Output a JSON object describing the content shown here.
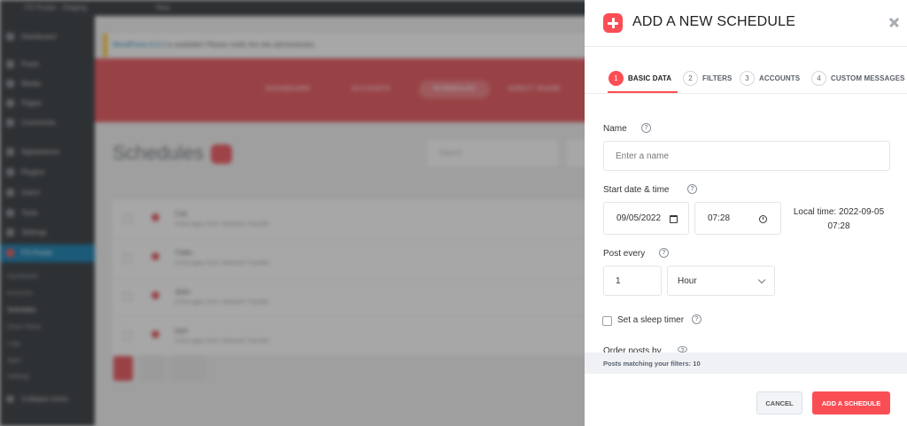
{
  "background": {
    "admin_bar": {
      "site_name": "FS Poster - Staging",
      "new_label": "New"
    },
    "sidebar": {
      "items": [
        "Dashboard",
        "Posts",
        "Media",
        "Pages",
        "Comments",
        "Appearance",
        "Plugins",
        "Users",
        "Tools",
        "Settings",
        "FS Poster"
      ],
      "submenu": [
        "Dashboard",
        "Accounts",
        "Schedules",
        "Direct Share",
        "Logs",
        "Apps",
        "Settings"
      ],
      "collapse": "Collapse menu"
    },
    "notice": {
      "link": "WordPress 6.0.2",
      "text": " is available! Please notify the site administrator."
    },
    "nav": [
      "DASHBOARD",
      "ACCOUNTS",
      "SCHEDULES",
      "DIRECT SHARE"
    ],
    "page_title": "Schedules",
    "search_placeholder": "Search",
    "rows": [
      {
        "title": "Cvb",
        "sub": "A few ages from: Network Transfer"
      },
      {
        "title": "Tvbfo",
        "sub": "A few ages from: Network Transfer"
      },
      {
        "title": "Jjvbv",
        "sub": "A few ages from: Network Transfer"
      },
      {
        "title": "Ioyh",
        "sub": "A few ages from: Network Transfer"
      }
    ]
  },
  "modal": {
    "title": "ADD A NEW SCHEDULE",
    "tabs": [
      {
        "num": "1",
        "label": "BASIC DATA"
      },
      {
        "num": "2",
        "label": "FILTERS"
      },
      {
        "num": "3",
        "label": "ACCOUNTS"
      },
      {
        "num": "4",
        "label": "CUSTOM MESSAGES"
      }
    ],
    "active_tab": "1",
    "name_label": "Name",
    "name_placeholder": "Enter a name",
    "start_label": "Start date & time",
    "date_value": "09/05/2022",
    "time_value": "07:28",
    "local_time_label": "Local time: 2022-09-05",
    "local_time_clock": "07:28",
    "post_every_label": "Post every",
    "interval_value": "1",
    "interval_unit": "Hour",
    "sleep_label": "Set a sleep timer",
    "order_label": "Order posts by",
    "help_glyph": "?",
    "matching_text": "Posts matching your filters: 10",
    "cancel_label": "CANCEL",
    "submit_label": "ADD A SCHEDULE"
  },
  "colors": {
    "accent": "#fb4e54",
    "wp_dark": "#23282d",
    "wp_blue": "#0073aa"
  }
}
